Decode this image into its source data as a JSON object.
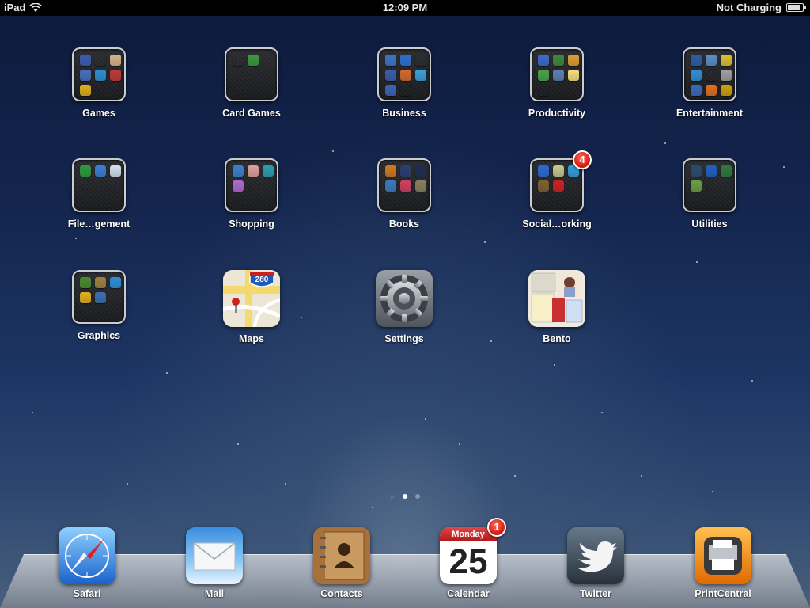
{
  "status_bar": {
    "device": "iPad",
    "time": "12:09 PM",
    "battery_text": "Not Charging",
    "battery_level": 0.9
  },
  "folders": [
    {
      "label": "Games",
      "minis": [
        "#3b5bb5",
        "#222",
        "#d8b48a",
        "#4a6fbf",
        "#2b8fd6",
        "#c03a3a",
        "#e0b020"
      ]
    },
    {
      "label": "Card Games",
      "minis": [
        "#555",
        "#3b9a3b"
      ]
    },
    {
      "label": "Business",
      "minis": [
        "#3c74c9",
        "#2f6fd0",
        "#9aa",
        "#3a5cab",
        "#d26b2c",
        "#3aa1d8",
        "#3b66b8",
        "#ccc"
      ]
    },
    {
      "label": "Productivity",
      "minis": [
        "#3a6bd0",
        "#3b8a3b",
        "#e0a030",
        "#4aa34a",
        "#5d7fb5",
        "#f4e080",
        "#333"
      ]
    },
    {
      "label": "Entertainment",
      "minis": [
        "#2b5da8",
        "#5a8fc8",
        "#e0c030",
        "#2f8fd8",
        "#444",
        "#a0a0a0",
        "#3a6ac0",
        "#e07020",
        "#d0a010"
      ]
    },
    {
      "label": "File…gement",
      "minis": [
        "#2e9a3e",
        "#3b7ed8",
        "#d6e0f0"
      ]
    },
    {
      "label": "Shopping",
      "minis": [
        "#3a80d0",
        "#e0a0a0",
        "#2aa0b0",
        "#b06ad0"
      ]
    },
    {
      "label": "Books",
      "minis": [
        "#d07a20",
        "#2b3e70",
        "#1e2e50",
        "#3a7ac0",
        "#d04060",
        "#8a8060"
      ]
    },
    {
      "label": "Social…orking",
      "minis": [
        "#2a6ad8",
        "#c8c890",
        "#30a0e0",
        "#806030",
        "#d02020"
      ],
      "badge": "4"
    },
    {
      "label": "Utilities",
      "minis": [
        "#2a4a70",
        "#2060c0",
        "#2e7a3e",
        "#6aa040"
      ]
    },
    {
      "label": "Graphics",
      "minis": [
        "#4a8a30",
        "#a08040",
        "#2a90d8",
        "#e0b020",
        "#3a70b0"
      ]
    }
  ],
  "apps": [
    {
      "label": "Maps",
      "highway": "280"
    },
    {
      "label": "Settings"
    },
    {
      "label": "Bento"
    }
  ],
  "dock": [
    {
      "label": "Safari"
    },
    {
      "label": "Mail"
    },
    {
      "label": "Contacts"
    },
    {
      "label": "Calendar",
      "weekday": "Monday",
      "day": "25",
      "badge": "1"
    },
    {
      "label": "Twitter"
    },
    {
      "label": "PrintCentral"
    }
  ],
  "page_indicator": {
    "pages": 2,
    "current": 1
  }
}
